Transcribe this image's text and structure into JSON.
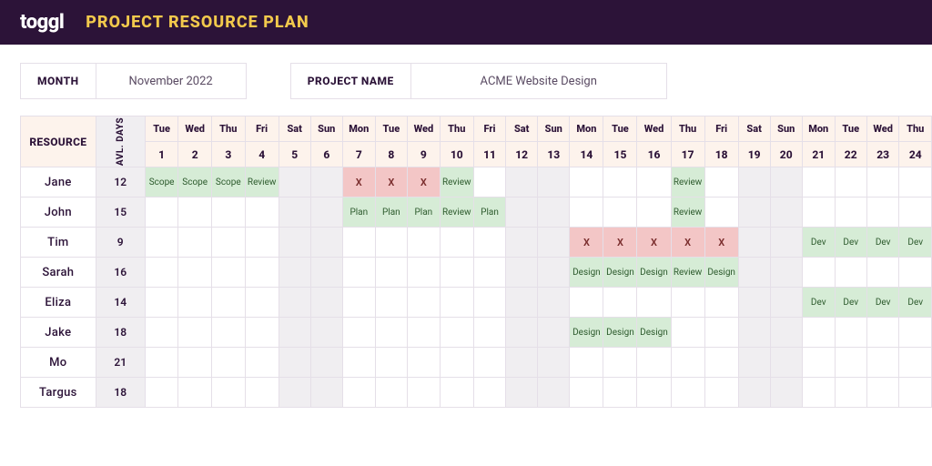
{
  "brand": "toggl",
  "title": "PROJECT RESOURCE PLAN",
  "fields": {
    "month_label": "MONTH",
    "month_value": "November 2022",
    "project_label": "PROJECT NAME",
    "project_value": "ACME Website Design"
  },
  "columns": {
    "resource_label": "RESOURCE",
    "avl_label": "AVL. DAYS"
  },
  "days": [
    {
      "dow": "Tue",
      "num": "1",
      "weekend": false
    },
    {
      "dow": "Wed",
      "num": "2",
      "weekend": false
    },
    {
      "dow": "Thu",
      "num": "3",
      "weekend": false
    },
    {
      "dow": "Fri",
      "num": "4",
      "weekend": false
    },
    {
      "dow": "Sat",
      "num": "5",
      "weekend": true
    },
    {
      "dow": "Sun",
      "num": "6",
      "weekend": true
    },
    {
      "dow": "Mon",
      "num": "7",
      "weekend": false
    },
    {
      "dow": "Tue",
      "num": "8",
      "weekend": false
    },
    {
      "dow": "Wed",
      "num": "9",
      "weekend": false
    },
    {
      "dow": "Thu",
      "num": "10",
      "weekend": false
    },
    {
      "dow": "Fri",
      "num": "11",
      "weekend": false
    },
    {
      "dow": "Sat",
      "num": "12",
      "weekend": true
    },
    {
      "dow": "Sun",
      "num": "13",
      "weekend": true
    },
    {
      "dow": "Mon",
      "num": "14",
      "weekend": false
    },
    {
      "dow": "Tue",
      "num": "15",
      "weekend": false
    },
    {
      "dow": "Wed",
      "num": "16",
      "weekend": false
    },
    {
      "dow": "Thu",
      "num": "17",
      "weekend": false
    },
    {
      "dow": "Fri",
      "num": "18",
      "weekend": false
    },
    {
      "dow": "Sat",
      "num": "19",
      "weekend": true
    },
    {
      "dow": "Sun",
      "num": "20",
      "weekend": true
    },
    {
      "dow": "Mon",
      "num": "21",
      "weekend": false
    },
    {
      "dow": "Tue",
      "num": "22",
      "weekend": false
    },
    {
      "dow": "Wed",
      "num": "23",
      "weekend": false
    },
    {
      "dow": "Thu",
      "num": "24",
      "weekend": false
    }
  ],
  "resources": [
    {
      "name": "Jane",
      "avl": "12",
      "cells": {
        "1": {
          "t": "Scope",
          "k": "task"
        },
        "2": {
          "t": "Scope",
          "k": "task"
        },
        "3": {
          "t": "Scope",
          "k": "task"
        },
        "4": {
          "t": "Review",
          "k": "task"
        },
        "7": {
          "t": "X",
          "k": "off"
        },
        "8": {
          "t": "X",
          "k": "off"
        },
        "9": {
          "t": "X",
          "k": "off"
        },
        "10": {
          "t": "Review",
          "k": "task"
        },
        "17": {
          "t": "Review",
          "k": "task"
        }
      }
    },
    {
      "name": "John",
      "avl": "15",
      "cells": {
        "7": {
          "t": "Plan",
          "k": "task"
        },
        "8": {
          "t": "Plan",
          "k": "task"
        },
        "9": {
          "t": "Plan",
          "k": "task"
        },
        "10": {
          "t": "Review",
          "k": "task"
        },
        "11": {
          "t": "Plan",
          "k": "task"
        },
        "17": {
          "t": "Review",
          "k": "task"
        }
      }
    },
    {
      "name": "Tim",
      "avl": "9",
      "cells": {
        "14": {
          "t": "X",
          "k": "off"
        },
        "15": {
          "t": "X",
          "k": "off"
        },
        "16": {
          "t": "X",
          "k": "off"
        },
        "17": {
          "t": "X",
          "k": "off"
        },
        "18": {
          "t": "X",
          "k": "off"
        },
        "21": {
          "t": "Dev",
          "k": "task"
        },
        "22": {
          "t": "Dev",
          "k": "task"
        },
        "23": {
          "t": "Dev",
          "k": "task"
        },
        "24": {
          "t": "Dev",
          "k": "task"
        }
      }
    },
    {
      "name": "Sarah",
      "avl": "16",
      "cells": {
        "14": {
          "t": "Design",
          "k": "task"
        },
        "15": {
          "t": "Design",
          "k": "task"
        },
        "16": {
          "t": "Design",
          "k": "task"
        },
        "17": {
          "t": "Review",
          "k": "task"
        },
        "18": {
          "t": "Design",
          "k": "task"
        }
      }
    },
    {
      "name": "Eliza",
      "avl": "14",
      "cells": {
        "21": {
          "t": "Dev",
          "k": "task"
        },
        "22": {
          "t": "Dev",
          "k": "task"
        },
        "23": {
          "t": "Dev",
          "k": "task"
        },
        "24": {
          "t": "Dev",
          "k": "task"
        }
      }
    },
    {
      "name": "Jake",
      "avl": "18",
      "cells": {
        "14": {
          "t": "Design",
          "k": "task"
        },
        "15": {
          "t": "Design",
          "k": "task"
        },
        "16": {
          "t": "Design",
          "k": "task"
        }
      }
    },
    {
      "name": "Mo",
      "avl": "21",
      "cells": {}
    },
    {
      "name": "Targus",
      "avl": "18",
      "cells": {}
    }
  ],
  "colors": {
    "brand_bg": "#2c1338",
    "accent": "#f2c94c",
    "header_cell": "#fdf3ec",
    "weekend": "#f0eef1",
    "task": "#d6ecd6",
    "off": "#f3c6c6"
  }
}
